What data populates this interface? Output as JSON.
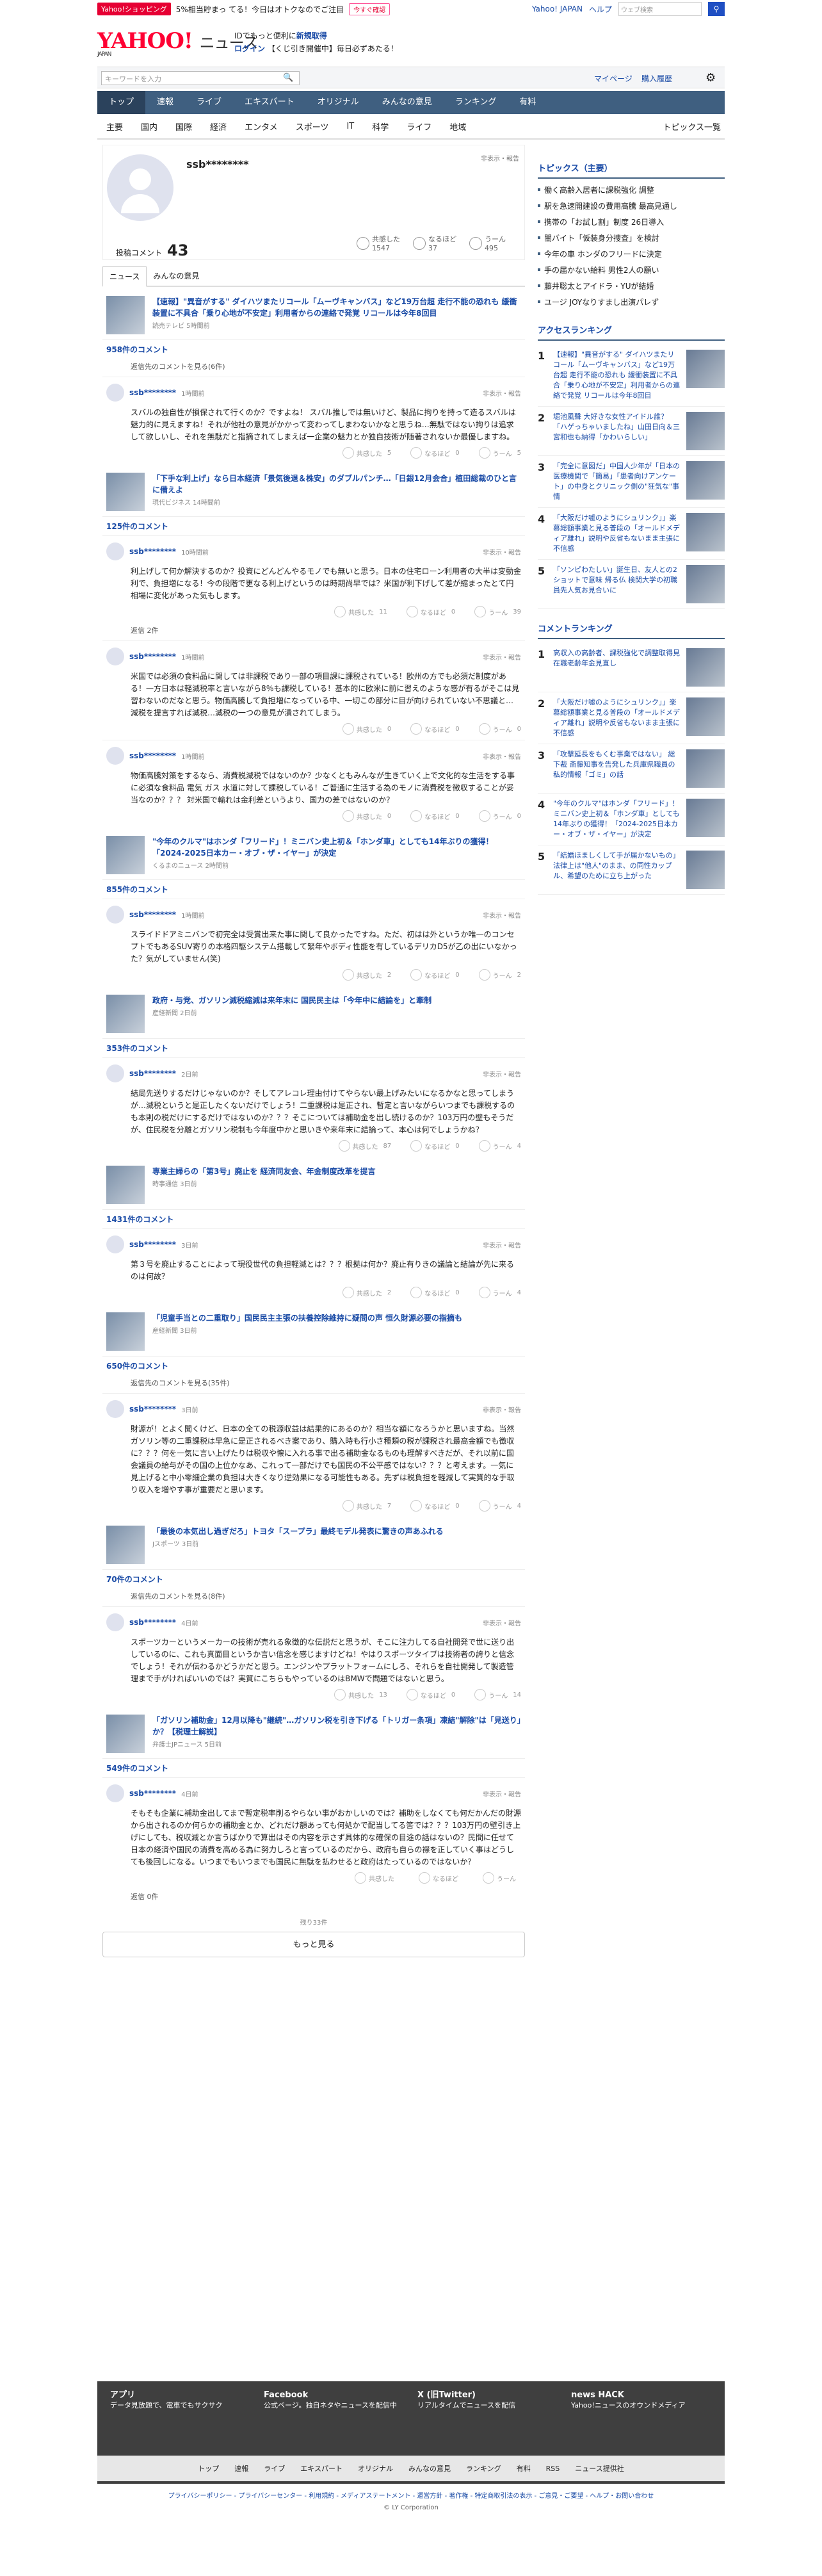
{
  "top": {
    "shop": "Yahoo!ショッピング",
    "promo": "5%相当貯まっ てる！今日はオトクなのでご注目",
    "promo_btn": "今すぐ確認",
    "yj": "Yahoo! JAPAN",
    "help": "ヘルプ",
    "search_ph": "ウェブ検索"
  },
  "header": {
    "logo": "YAHOO!",
    "logo_sub": "ニュース",
    "logo_small": "JAPAN",
    "msg1": "IDでもっと便利に",
    "msg1b": "新規取得",
    "msg2": "ログイン",
    "msg2c": "【くじ引き開催中】毎日必ずあたる！"
  },
  "search": {
    "placeholder": "キーワードを入力",
    "mypage": "マイページ",
    "buy": "購入履歴"
  },
  "nav1": [
    "トップ",
    "速報",
    "ライブ",
    "エキスパート",
    "オリジナル",
    "みんなの意見",
    "ランキング",
    "有料"
  ],
  "nav2": [
    "主要",
    "国内",
    "国際",
    "経済",
    "エンタメ",
    "スポーツ",
    "IT",
    "科学",
    "ライフ",
    "地域"
  ],
  "nav2_last": "トピックス一覧",
  "profile": {
    "name": "ssb********",
    "report": "非表示・報告",
    "comments_label": "投稿コメント",
    "comments": "43",
    "s1l": "共感した",
    "s1": "1547",
    "s2l": "なるほど",
    "s2": "37",
    "s3l": "うーん",
    "s3": "495"
  },
  "tabs": [
    "ニュース",
    "みんなの意見"
  ],
  "articles": [
    {
      "title": "【速報】\"異音がする\" ダイハツまたリコール「ムーヴキャンバス」など19万台超 走行不能の恐れも 緩衝装置に不具合「乗り心地が不安定」利用者からの連絡で発覚 リコールは今年8回目",
      "src": "読売テレビ 5時間前",
      "count": "958件のコメント",
      "more": "返信先のコメントを見る(6件)",
      "c": {
        "name": "ssb********",
        "time": "1時間前",
        "body": "スバルの独自性が損保されて行くのか？ですよね！ スバル推しでは無いけど、製品に拘りを持って造るスバルは魅力的に見えますね！それが他社の意見がかかって変わってしまわないかなと思うね…無駄ではない拘りは追求して欲しいし、それを無駄だと指摘されてしまえば一企業の魅力とか独自技術が随著されないか最優しますね。",
        "a": "5",
        "b": "0",
        "d": "5"
      }
    },
    {
      "title": "「下手な利上げ」なら日本経済「景気後退＆株安」のダブルパンチ…「日銀12月会合」植田総裁のひと言に備えよ",
      "src": "現代ビジネス 14時間前",
      "count": "125件のコメント",
      "c": {
        "name": "ssb********",
        "time": "10時間前",
        "body": "利上げして何か解決するのか？投資にどんどんやるモノでも無いと思う。日本の住宅ローン利用者の大半は変動金利で、負担増になる！今の段階で更なる利上げというのは時期尚早では？米国が利下げして差が縮まったとて円相場に変化があった気もします。",
        "a": "11",
        "b": "0",
        "d": "39"
      },
      "reply": "返信 2件",
      "c2": {
        "name": "ssb********",
        "time": "1時間前",
        "body": "米国では必須の食料品に関しては非課税であり一部の項目課に課税されている！欧州の方でも必須だ制度がある！一方日本は軽減税率と言いながら8％も課税している！基本的に欧米に前に習えのような感が有るがそこは見習わないのだなと思う。物価高騰して負担増になっている中、一切この部分に目が向けられていない不思議と… 減税を提言すれば減税…減税の一つの意見が潰されてしまう。",
        "a": "0",
        "b": "0",
        "d": "0"
      },
      "c3": {
        "name": "ssb********",
        "time": "1時間前",
        "body": "物価高騰対策をするなら、消費税減税ではないのか？少なくともみんなが生きていく上で文化的な生活をする事に必須な食料品 電気 ガス 水道に対して課税している！ご普通に生活する為のモノに消費税を徴収することが妥当なのか？？？ 対米国で輸れは金利差というより、国力の差ではないのか？",
        "a": "0",
        "b": "0",
        "d": "0"
      }
    },
    {
      "title": "\"今年のクルマ\"はホンダ「フリード」！ミニバン史上初＆「ホンダ車」としても14年ぶりの獲得！「2024-2025日本カー・オブ・ザ・イヤー」が決定",
      "src": "くるまのニュース 2時間前",
      "count": "855件のコメント",
      "c": {
        "name": "ssb********",
        "time": "1時間前",
        "body": "スライドドアミニバンで初完全は受賞出来た事に関して良かったですね。ただ、初はは外というか唯一のコンセプトでもあるSUV寄りの本格四駆システム搭載して緊年やボディ性能を有しているデリカD5が乙の出にいなかった？気がしていません(笑)",
        "a": "2",
        "b": "0",
        "d": "2"
      }
    },
    {
      "title": "政府・与党、ガソリン減税縮減は来年末に 国民民主は「今年中に結論を」と牽制",
      "src": "産経新聞 2日前",
      "count": "353件のコメント",
      "c": {
        "name": "ssb********",
        "time": "2日前",
        "body": "結局先送りするだけじゃないのか？そしてアレコレ理由付けてやらない最上げみたいになるかなと思ってしまうが…減税というと是正したくないだけでしょう！二重課税は是正され、暫定と言いながらいつまでも課税するのも本則の税だけにするだけではないのか？？？そこについては補助金を出し続けるのか？103万円の壁もそうだが、住民税を分離とガソリン税制も今年度中かと思いきや来年末に結論って、本心は何でしょうかね？",
        "a": "87",
        "b": "0",
        "d": "4"
      }
    },
    {
      "title": "専業主婦らの「第3号」廃止を 経済同友会、年金制度改革を提言",
      "src": "時事通信 3日前",
      "count": "1431件のコメント",
      "c": {
        "name": "ssb********",
        "time": "3日前",
        "body": "第３号を廃止することによって現役世代の負担軽減とは？？？根拠は何か？廃止有りきの議論と結論が先に来るのは何故？",
        "a": "2",
        "b": "0",
        "d": "4"
      }
    },
    {
      "title": "「児童手当との二重取り」国民民主主張の扶養控除維持に疑問の声 恒久財源必要の指摘も",
      "src": "産経新聞 3日前",
      "count": "650件のコメント",
      "more": "返信先のコメントを見る(35件)",
      "c": {
        "name": "ssb********",
        "time": "3日前",
        "body": "財源が！とよく聞くけど、日本の全ての税源収益は結果的にあるのか？相当な額になろうかと思いますね。当然ガソリン等の二重課税は早急に是正されるべき案であり、購入時も行小さ種類の税が課税され最高金額でも徴収に？？？何を一気に言い上げたりは税収や懐に入れる事で出る補助金なるものも理解すべきだが、それ以前に国会議員の給与がその国の上位かなあ、これって一部だけでも国民の不公平感ではない？？？と考えます。一気に見上げると中小零細企業の負担は大きくなり逆効果になる可能性もある。先ずは税負担を軽減して実質的な手取り収入を増やす事が重要だと思います。",
        "a": "7",
        "b": "0",
        "d": "4"
      }
    },
    {
      "title": "「最後の本気出し過ぎだろ」トヨタ「スープラ」最終モデル発表に驚きの声あふれる",
      "src": "Jスポーツ 3日前",
      "count": "70件のコメント",
      "more": "返信先のコメントを見る(8件)",
      "c": {
        "name": "ssb********",
        "time": "4日前",
        "body": "スポーツカーというメーカーの技術が売れる象徴的な伝説だと思うが、そこに注力してる自社開発で世に送り出しているのに、これも真面目というか言い信念を感じますけどね！やはりスポーツタイプは技術者の誇りと信念でしょう！それが伝わるかどうかだと思う。エンジンやプラットフォームにしろ、それらを自社開発して製造管理まで手がければいいのでは？実質にこちらもやっているのはBMWで問題ではないと思う。",
        "a": "13",
        "b": "0",
        "d": "14"
      }
    },
    {
      "title": "「ガソリン補助金」12月以降も\"継続\"…ガソリン税を引き下げる「トリガー条項」凍結\"解除\"は「見送り」か？【税理士解説】",
      "src": "弁護士JPニュース 5日前",
      "count": "549件のコメント",
      "c": {
        "name": "ssb********",
        "time": "4日前",
        "body": "そもそも企業に補助金出してまで暫定税率削るやらない事がおかしいのでは？補助をしなくても何だかんだの財源から出されるのか何らかの補助金とか、どれだけ額あっても何処かで配当してる筈では？？？103万円の壁引き上げにしても、税収減とか言うばかりで算出はその内容を示さず具体的な確保の目途の話はないの？民間に任せて日本の経済や国民の消費を高める為に努力しろと言っているのだから、政府も自らの襟を正していく事はどうしても後回しになる。いつまでもいつまでも国民に無駄を払わせると政府はたっているのではないか？",
        "a": "",
        "b": "",
        "d": ""
      },
      "reply": "返信 0件"
    }
  ],
  "pager": "残り33件",
  "showmore": "もっと見る",
  "side": {
    "topics_title": "トピックス（主要）",
    "topics": [
      "働く高齢入居者に課税強化 調整",
      "駅を急速開建設の費用高騰 最高見通し",
      "携帯の「お試し割」制度 26日導入",
      "闇バイト「仮装身分捜査」を検討",
      "今年の車 ホンダのフリードに決定",
      "手の届かない給料 男性2人の願い",
      "藤井聡太とアイドラ・YUが結婚",
      "ユージ JOYなりすまし出演パレず"
    ],
    "acc_title": "アクセスランキング",
    "acc": [
      {
        "t": "【速報】\"異音がする\" ダイハツまたリコール「ムーヴキャンバス」など19万台超 走行不能の恐れも 緩衝装置に不具合「乗り心地が不安定」利用者からの連絡で発覚 リコールは今年8回目",
        "s": "読売テレビ 12/5(木) 14:07"
      },
      {
        "t": "堀池風聲 大好きな女性アイドル誰？「ハゲっちゃいましたね」山田日向＆三宮和也も納得「かわいらしい」",
        "s": "スポニチアネックス 12/5(木) 16:55"
      },
      {
        "t": "「完全に意図だ」中国人少年が「日本の医療機関で「簡易」「患者向けアンケート」の中身とクリニック側の\"狂気な\"事情",
        "s": "弁護士ドットコム 12/5(木) 10:42"
      },
      {
        "t": "「大阪だけ嘘のようにシュリンク」」楽慕総額事業と見る普段の「オールドメディア離れ」説明や反省もないまま主張に不信感",
        "s": "デイリースポーツ 12/5(木) 17:06"
      },
      {
        "t": "「ソンピわたしい」誕生日、友人との2ショットで意味 帰る仏 検関大学の初職員先人気お見合いに",
        "s": "ねとらぼ 12/5(木) 16:29"
      }
    ],
    "cr_title": "コメントランキング",
    "cr": [
      {
        "t": "高収入の高齢者、課税強化で調整取得見 在職老齢年金見直し",
        "s": "時事通信 12/5(木) 14:38"
      },
      {
        "t": "「大阪だけ嘘のようにシュリンク」」楽慕総額事業と見る普段の「オールドメディア離れ」説明や反省もないまま主張に不信感",
        "s": "デイリースポーツ 12/5(木) 17:06"
      },
      {
        "t": "「攻撃延長をもくむ事業ではない」 総下裁 斎藤知事を告発した兵庫県職員の私的情報「ゴミ」の話",
        "s": "毎日放送 12/5(木) 17:12"
      },
      {
        "t": "\"今年のクルマ\"はホンダ「フリード」！ミニバン史上初＆「ホンダ車」としても14年ぶりの獲得！「2024-2025日本カー・オブ・ザ・イヤー」が決定",
        "s": "くるまのニュース 12/5(木) 16:52"
      },
      {
        "t": "「結婚ほましくして手が届かないもの」 法律上は\"他人\"のまま、の同性カップル、希望のために立ち上がった",
        "s": "ＲＫＢ毎日放送 12/5(木) 17:01"
      }
    ]
  },
  "footer": {
    "app": "アプリ",
    "app_d": "データ見放題で、電車でもサクサク",
    "fb": "Facebook",
    "fb_d": "公式ページ。独自ネタやニュースを配信中",
    "x": "X (旧Twitter)",
    "x_d": "リアルタイムでニュースを配信",
    "hack": "news HACK",
    "hack_d": "Yahoo!ニュースのオウンドメディア",
    "nav": [
      "トップ",
      "速報",
      "ライブ",
      "エキスパート",
      "オリジナル",
      "みんなの意見",
      "ランキング",
      "有料",
      "RSS",
      "ニュース提供社"
    ],
    "links": "プライバシーポリシー - プライバシーセンター - 利用規約 - メディアステートメント - 運営方針 - 著作権 - 特定商取引法の表示 - ご意見・ご要望 - ヘルプ・お問い合わせ",
    "copy": "© LY Corporation"
  }
}
